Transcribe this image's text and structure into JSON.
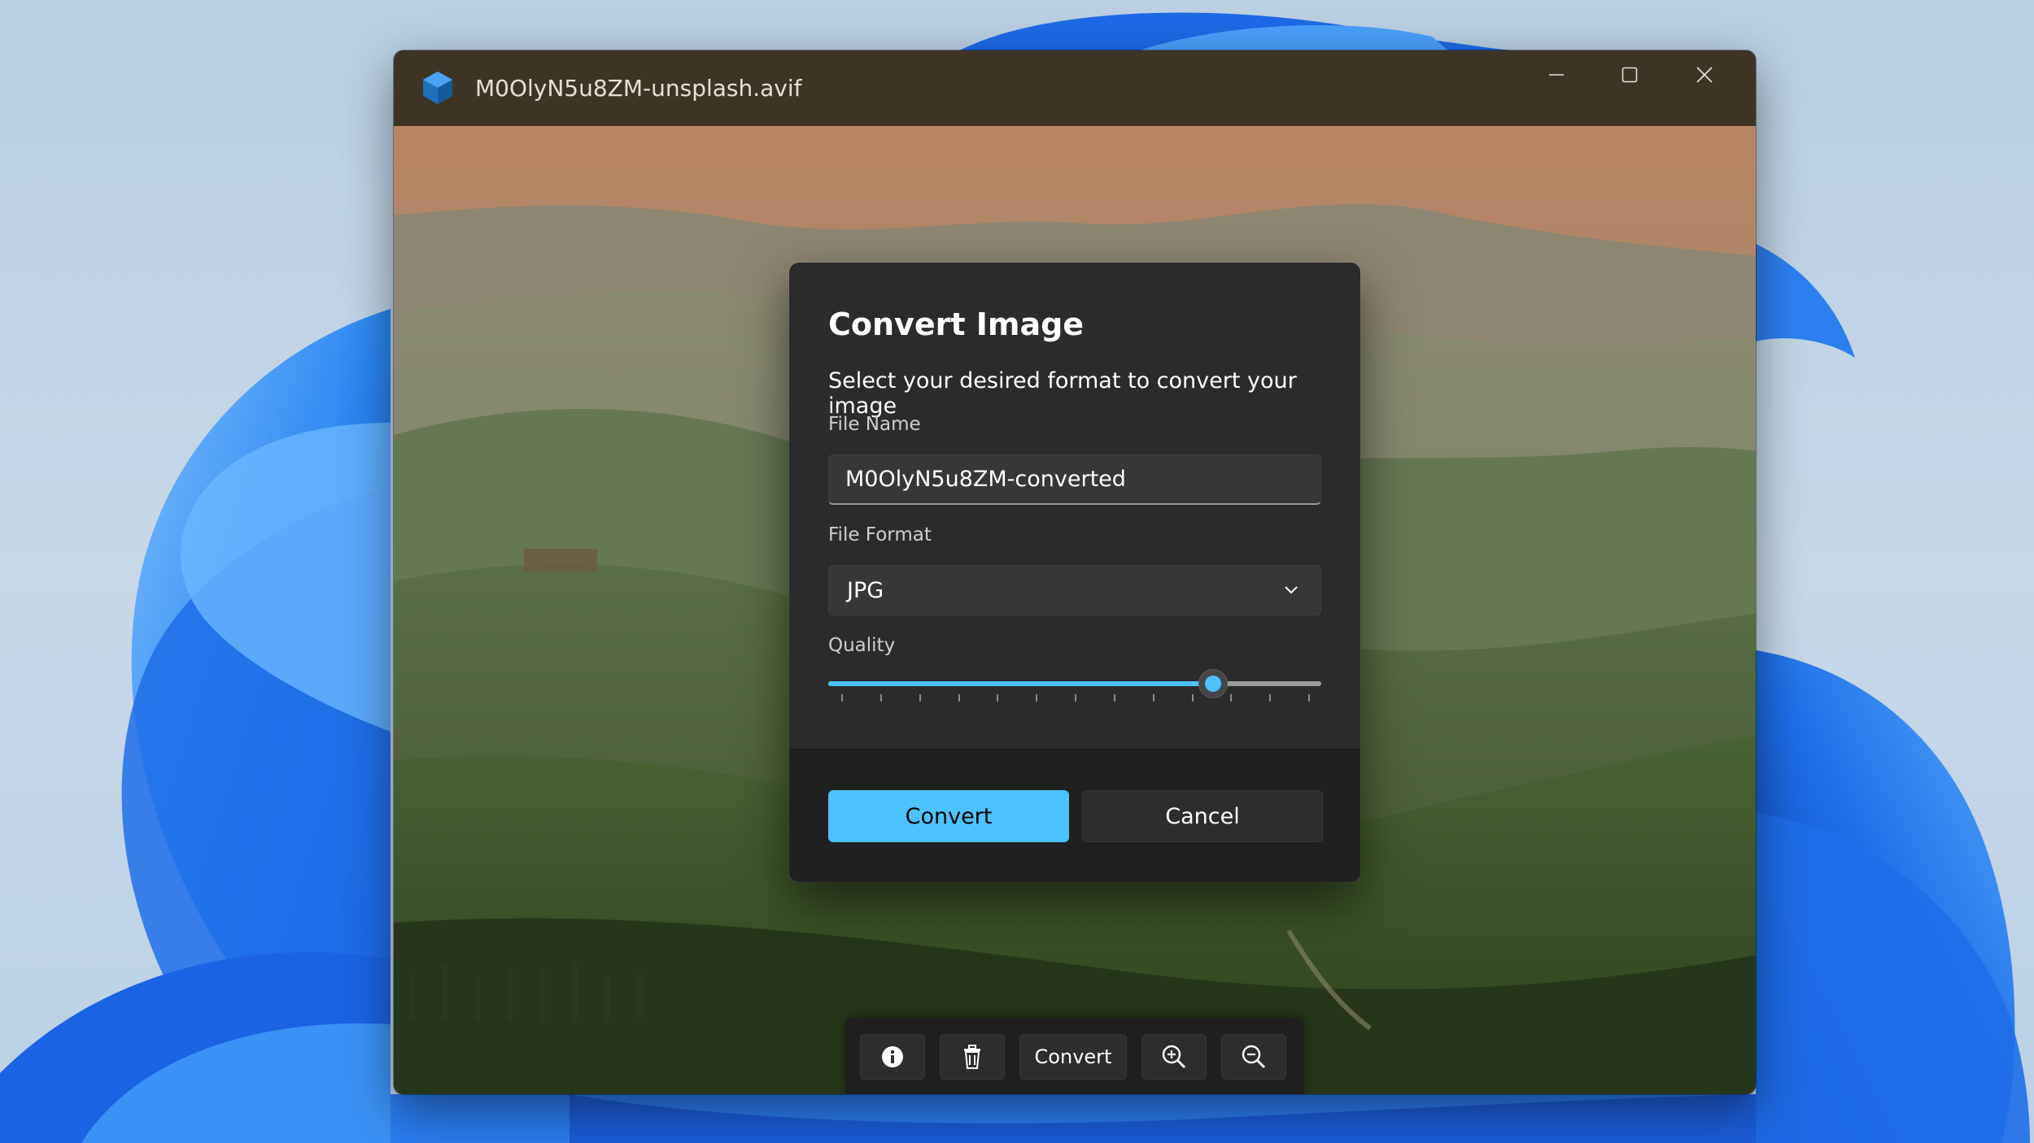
{
  "window": {
    "title": "M0OlyN5u8ZM-unsplash.avif",
    "controls": [
      "minimize-icon",
      "maximize-icon",
      "close-icon"
    ]
  },
  "dialog": {
    "title": "Convert Image",
    "subtitle": "Select your desired format to convert your image",
    "file_name": {
      "label": "File Name",
      "value": "M0OlyN5u8ZM-converted"
    },
    "file_format": {
      "label": "File Format",
      "selected": "JPG"
    },
    "quality": {
      "label": "Quality",
      "value_fraction": 0.78,
      "tick_count": 13
    },
    "buttons": {
      "primary": "Convert",
      "secondary": "Cancel"
    }
  },
  "toolbar": {
    "items": [
      {
        "icon": "info-icon"
      },
      {
        "icon": "trash-icon"
      },
      {
        "label": "Convert"
      },
      {
        "icon": "zoom-in-icon"
      },
      {
        "icon": "zoom-out-icon"
      }
    ]
  },
  "colors": {
    "accent": "#4cc2ff",
    "dialog_bg": "#2b2b2b",
    "footer_bg": "#202020",
    "titlebar_bg": "#3e3426"
  }
}
